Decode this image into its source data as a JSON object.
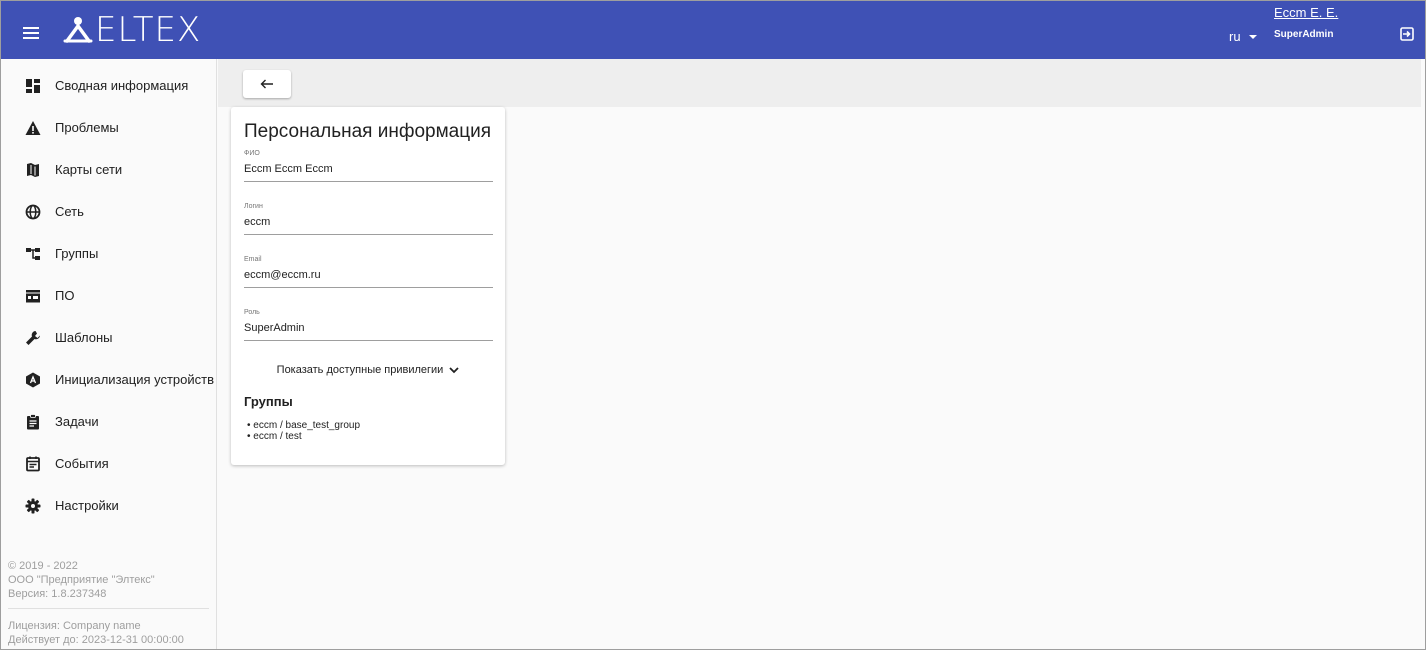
{
  "header": {
    "logo_text": "ELTEX",
    "language": "ru",
    "user_name": "Eccm E. E.",
    "user_role": "SuperAdmin",
    "bar_color": "#3f51b5"
  },
  "sidebar": {
    "items": [
      {
        "label": "Сводная информация",
        "icon": "dashboard-icon"
      },
      {
        "label": "Проблемы",
        "icon": "warning-icon"
      },
      {
        "label": "Карты сети",
        "icon": "map-icon"
      },
      {
        "label": "Сеть",
        "icon": "globe-icon"
      },
      {
        "label": "Группы",
        "icon": "groups-tree-icon"
      },
      {
        "label": "ПО",
        "icon": "software-icon"
      },
      {
        "label": "Шаблоны",
        "icon": "wrench-icon"
      },
      {
        "label": "Инициализация устройств",
        "icon": "device-init-icon"
      },
      {
        "label": "Задачи",
        "icon": "clipboard-icon"
      },
      {
        "label": "События",
        "icon": "events-icon"
      },
      {
        "label": "Настройки",
        "icon": "gear-icon"
      }
    ],
    "footer": {
      "copyright": "© 2019 - 2022",
      "company": "ООО \"Предприятие \"Элтекс\"",
      "version": "Версия: 1.8.237348",
      "license": "Лицензия: Company name",
      "valid_until": "Действует до: 2023-12-31 00:00:00"
    }
  },
  "card": {
    "title": "Персональная информация",
    "fields": [
      {
        "label": "ФИО",
        "value": "Eccm Eccm Eccm"
      },
      {
        "label": "Логин",
        "value": "eccm"
      },
      {
        "label": "Email",
        "value": "eccm@eccm.ru"
      },
      {
        "label": "Роль",
        "value": "SuperAdmin"
      }
    ],
    "privileges_button": "Показать доступные привилегии",
    "groups_title": "Группы",
    "groups": [
      "eccm / base_test_group",
      "eccm / test"
    ]
  }
}
